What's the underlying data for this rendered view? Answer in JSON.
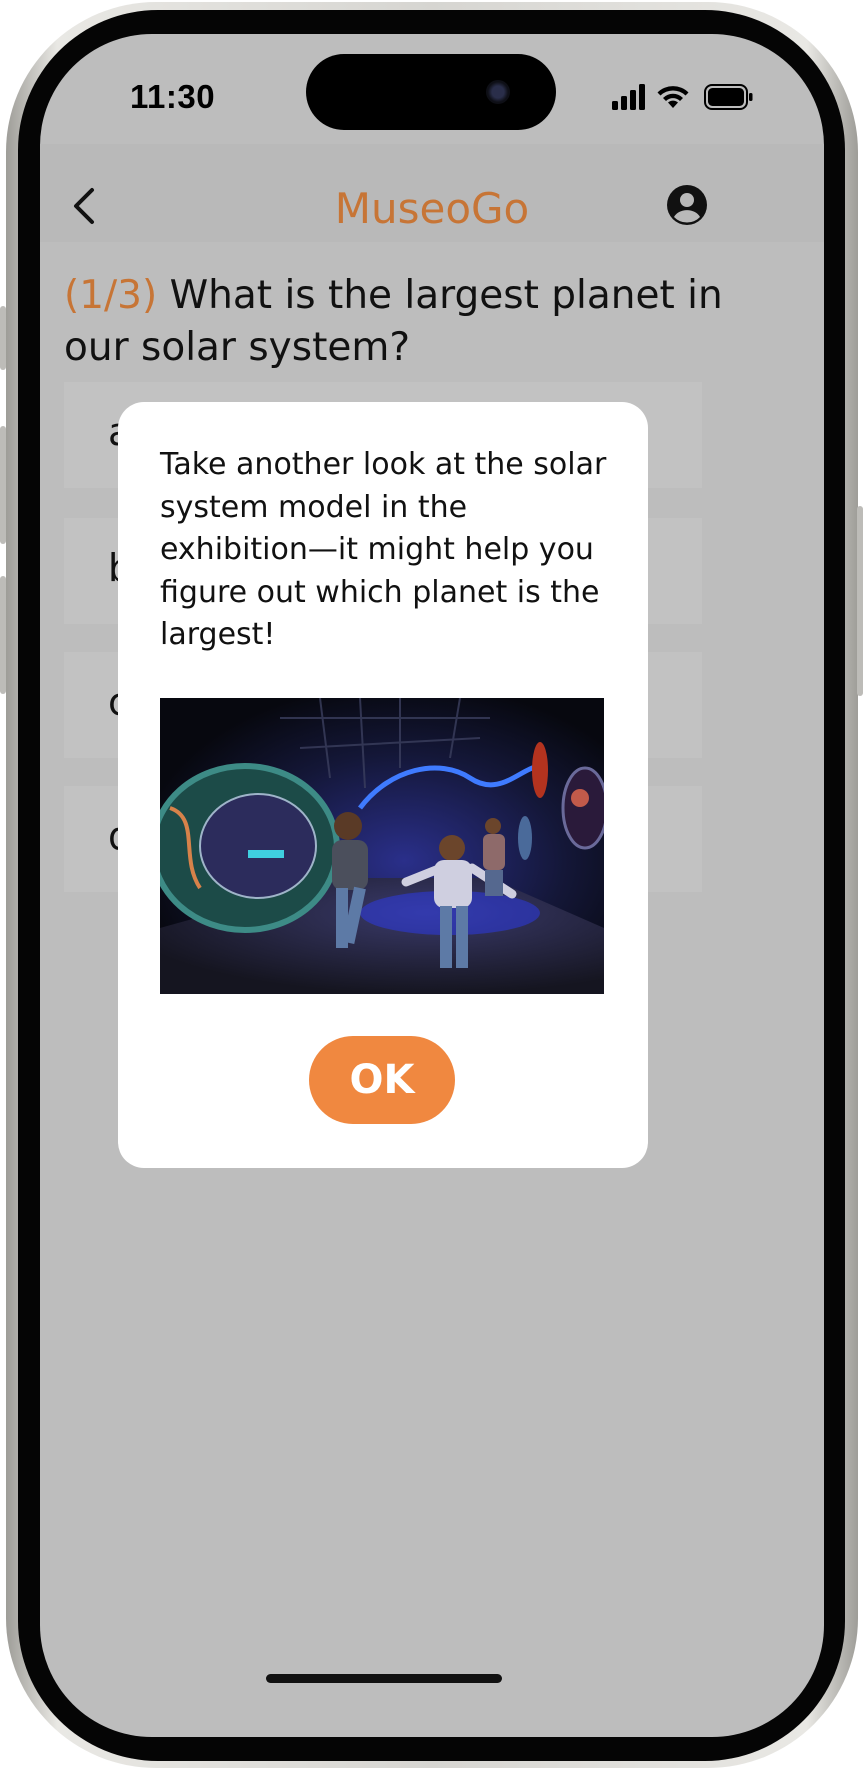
{
  "status_bar": {
    "time": "11:30"
  },
  "header": {
    "app_title": "MuseoGo"
  },
  "question": {
    "number": "(1/3)",
    "text": "What is the largest planet in our solar system?"
  },
  "options": [
    {
      "letter": "a"
    },
    {
      "letter": "b"
    },
    {
      "letter": "c"
    },
    {
      "letter": "d"
    }
  ],
  "dialog": {
    "message": "Take another look at the solar system model in the exhibition—it might help you figure out which planet is the largest!",
    "ok_label": "OK"
  },
  "colors": {
    "accent": "#c77536",
    "button": "#f08840",
    "overlay": "#bdbdbd"
  }
}
